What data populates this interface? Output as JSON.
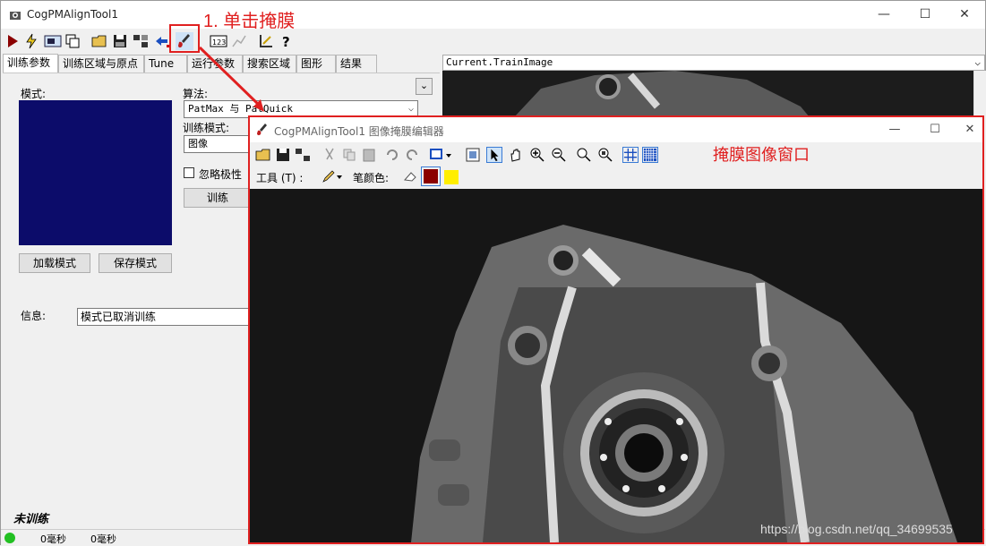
{
  "window": {
    "title": "CogPMAlignTool1"
  },
  "annotations": {
    "step1": "1. 单击掩膜",
    "mask_window": "掩膜图像窗口"
  },
  "tabs": [
    {
      "label": "训练参数"
    },
    {
      "label": "训练区域与原点"
    },
    {
      "label": "Tune"
    },
    {
      "label": "运行参数"
    },
    {
      "label": "搜索区域"
    },
    {
      "label": "图形"
    },
    {
      "label": "结果"
    }
  ],
  "panel": {
    "pattern_label": "模式:",
    "algorithm_label": "算法:",
    "algorithm_value": "PatMax 与 PatQuick",
    "train_mode_label": "训练模式:",
    "train_mode_value": "图像",
    "ignore_polarity": "忽略极性",
    "train_button": "训练",
    "load_pattern": "加载模式",
    "save_pattern": "保存模式",
    "info_label": "信息:",
    "info_value": "模式已取消训练"
  },
  "right_pane": {
    "image_selector": "Current.TrainImage"
  },
  "status": {
    "untrained": "未训练",
    "time1": "0毫秒",
    "time2": "0毫秒"
  },
  "mask_editor": {
    "title": "CogPMAlignTool1 图像掩膜编辑器",
    "tool_label": "工具 (T) :",
    "pen_color_label": "笔颜色:",
    "colors": {
      "dark_red": "#8b0000",
      "yellow": "#ffee00"
    },
    "watermark": "https://blog.csdn.net/qq_34699535"
  },
  "colors": {
    "annotation": "#e02020",
    "pattern_bg": "#0c0c6a"
  }
}
